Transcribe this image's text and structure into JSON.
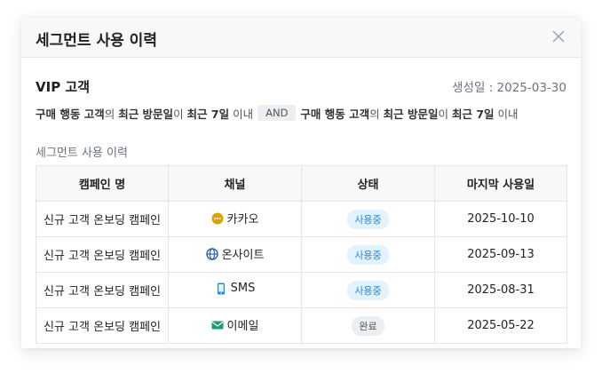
{
  "modal": {
    "title": "세그먼트 사용 이력"
  },
  "segment": {
    "name": "VIP 고객",
    "created_label": "생성일 : 2025-03-30",
    "condition_left": [
      {
        "text": "구매 행동 고객",
        "bold": true
      },
      {
        "text": "의 ",
        "bold": false
      },
      {
        "text": "최근 방문일",
        "bold": true
      },
      {
        "text": "이 ",
        "bold": false
      },
      {
        "text": "최근 7일",
        "bold": true
      },
      {
        "text": " 이내",
        "bold": false
      }
    ],
    "operator": "AND",
    "condition_right": [
      {
        "text": "구매 행동 고객",
        "bold": true
      },
      {
        "text": "의 ",
        "bold": false
      },
      {
        "text": "최근 방문일",
        "bold": true
      },
      {
        "text": "이 ",
        "bold": false
      },
      {
        "text": "최근 7일",
        "bold": true
      },
      {
        "text": " 이내",
        "bold": false
      }
    ]
  },
  "history": {
    "section_label": "세그먼트 사용 이력",
    "columns": [
      "캠페인 명",
      "채널",
      "상태",
      "마지막 사용일"
    ],
    "rows": [
      {
        "campaign": "신규 고객 온보딩 캠페인",
        "channel": "카카오",
        "channel_icon": "kakao-icon",
        "status": "사용중",
        "status_type": "active",
        "last_used": "2025-10-10"
      },
      {
        "campaign": "신규 고객 온보딩 캠페인",
        "channel": "온사이트",
        "channel_icon": "globe-icon",
        "status": "사용중",
        "status_type": "active",
        "last_used": "2025-09-13"
      },
      {
        "campaign": "신규 고객 온보딩 캠페인",
        "channel": "SMS",
        "channel_icon": "mobile-icon",
        "status": "사용중",
        "status_type": "active",
        "last_used": "2025-08-31"
      },
      {
        "campaign": "신규 고객 온보딩 캠페인",
        "channel": "이메일",
        "channel_icon": "mail-icon",
        "status": "완료",
        "status_type": "done",
        "last_used": "2025-05-22"
      }
    ]
  },
  "colors": {
    "kakao": "#d9a400",
    "globe": "#2b5fb8",
    "mobile": "#1e88e5",
    "mail": "#1a9e6a"
  }
}
